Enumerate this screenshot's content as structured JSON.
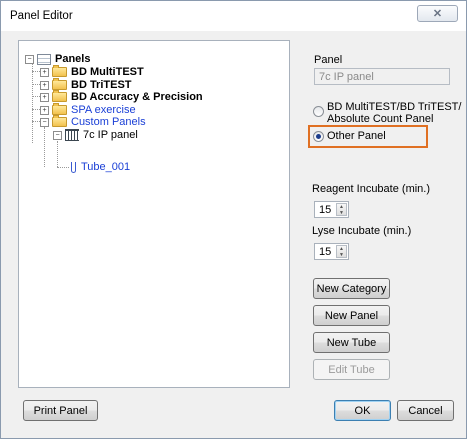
{
  "window": {
    "title": "Panel Editor",
    "close_glyph": "✕"
  },
  "tree": {
    "root": "Panels",
    "items": [
      {
        "label": "BD MultiTEST",
        "style": "bold"
      },
      {
        "label": "BD TriTEST",
        "style": "bold"
      },
      {
        "label": "BD Accuracy & Precision",
        "style": "bold"
      },
      {
        "label": "SPA exercise",
        "style": "blue"
      },
      {
        "label": "Custom Panels",
        "style": "blue"
      },
      {
        "label": "7c IP panel",
        "style": "normal"
      },
      {
        "label": "Tube_001",
        "style": "blue"
      }
    ]
  },
  "panel": {
    "label": "Panel",
    "name_value": "7c IP panel",
    "option1_line1": "BD MultiTEST/BD TriTEST/",
    "option1_line2": "Absolute Count Panel",
    "option2": "Other Panel",
    "selected_option": "Other Panel"
  },
  "incubation": {
    "reagent_label": "Reagent Incubate (min.)",
    "reagent_value": "15",
    "lyse_label": "Lyse Incubate (min.)",
    "lyse_value": "15"
  },
  "buttons": {
    "new_category": "New Category",
    "new_panel": "New Panel",
    "new_tube": "New Tube",
    "edit_tube": "Edit Tube",
    "print_panel": "Print Panel",
    "ok": "OK",
    "cancel": "Cancel"
  },
  "colors": {
    "highlight": "#e07023",
    "blue_text": "#1a3fd6"
  }
}
